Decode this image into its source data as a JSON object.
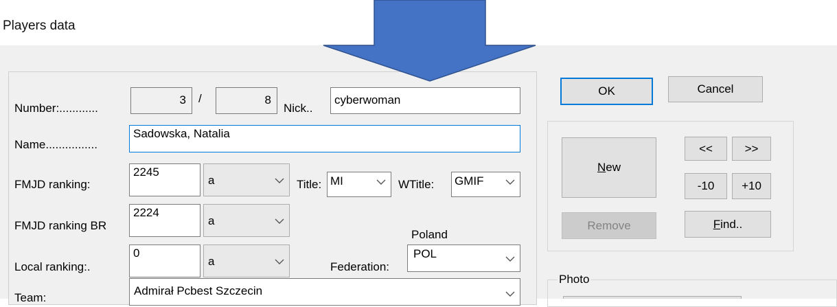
{
  "window": {
    "title": "Players data"
  },
  "fields": {
    "number_label": "Number:............",
    "number_value": "3",
    "number_separator": "/",
    "number_total": "8",
    "nick_label": "Nick..",
    "nick_value": "cyberwoman",
    "name_label": "Name................",
    "name_value": "Sadowska, Natalia",
    "fmjd_ranking_label": "FMJD ranking:",
    "fmjd_ranking_value": "2245",
    "fmjd_ranking_category": "a",
    "title_label": "Title:",
    "title_value": "MI",
    "wtitle_label": "WTitle:",
    "wtitle_value": "GMIF",
    "fmjd_ranking_br_label": "FMJD ranking BR",
    "fmjd_ranking_br_value": "2224",
    "fmjd_ranking_br_category": "a",
    "federation_country": "Poland",
    "local_ranking_label": "Local ranking:.",
    "local_ranking_value": "0",
    "local_ranking_category": "a",
    "federation_label": "Federation:",
    "federation_value": "POL",
    "team_label": "Team:",
    "team_value": "Admirał Pcbest Szczecin"
  },
  "buttons": {
    "ok": "OK",
    "cancel": "Cancel",
    "new_mnemonic": "N",
    "new_rest": "ew",
    "prev": "<<",
    "next": ">>",
    "minus10": "-10",
    "plus10": "+10",
    "remove": "Remove",
    "find_mnemonic": "F",
    "find_rest": "ind.."
  },
  "photo": {
    "label": "Photo"
  },
  "annotation": {
    "arrow_color": "#4472c4",
    "arrow_outline": "#2f528f",
    "arrow_direction": "down"
  },
  "icons": {
    "dropdown": "chevron-down-icon",
    "arrow": "down-arrow-icon"
  }
}
